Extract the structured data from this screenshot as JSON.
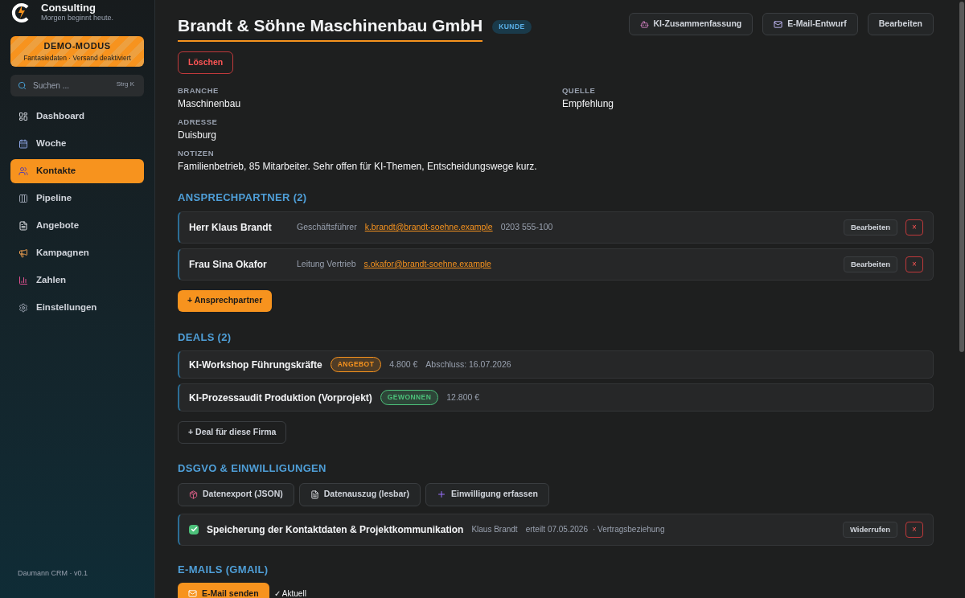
{
  "brand": {
    "name": "Consulting",
    "tagline": "Morgen beginnt heute."
  },
  "demo": {
    "title": "DEMO-MODUS",
    "subtitle": "Fantasiedaten · Versand deaktiviert"
  },
  "search": {
    "placeholder": "Suchen ...",
    "shortcut": "Strg K"
  },
  "nav": [
    {
      "label": "Dashboard",
      "selected": false
    },
    {
      "label": "Woche",
      "selected": false
    },
    {
      "label": "Kontakte",
      "selected": true
    },
    {
      "label": "Pipeline",
      "selected": false
    },
    {
      "label": "Angebote",
      "selected": false
    },
    {
      "label": "Kampagnen",
      "selected": false
    },
    {
      "label": "Zahlen",
      "selected": false
    },
    {
      "label": "Einstellungen",
      "selected": false
    }
  ],
  "version": "Daumann CRM · v0.1",
  "company": {
    "name": "Brandt & Söhne Maschinenbau GmbH",
    "badge": "KUNDE",
    "delete": "Löschen"
  },
  "actions": [
    "KI-Zusammenfassung",
    "E-Mail-Entwurf",
    "Bearbeiten"
  ],
  "fields": [
    {
      "label": "BRANCHE",
      "value": "Maschinenbau"
    },
    {
      "label": "QUELLE",
      "value": "Empfehlung"
    },
    {
      "label": "ADRESSE",
      "value": "Duisburg"
    }
  ],
  "notes": {
    "label": "NOTIZEN",
    "value": "Familienbetrieb, 85 Mitarbeiter. Sehr offen für KI-Themen, Entscheidungswege kurz."
  },
  "contacts": {
    "title": "ANSPRECHPARTNER (2)",
    "add": "+ Ansprechpartner",
    "items": [
      {
        "name": "Herr Klaus Brandt",
        "role": "Geschäftsführer",
        "email": "k.brandt@brandt-soehne.example",
        "phone": "0203 555-100",
        "edit": "Bearbeiten",
        "remove": "×"
      },
      {
        "name": "Frau Sina Okafor",
        "role": "Leitung Vertrieb",
        "email": "s.okafor@brandt-soehne.example",
        "edit": "Bearbeiten",
        "remove": "×"
      }
    ]
  },
  "deals": {
    "title": "DEALS (2)",
    "add": "+ Deal für diese Firma",
    "items": [
      {
        "name": "KI-Workshop Führungskräfte",
        "stage": "ANGEBOT",
        "color": "#f7931e",
        "amount": "4.800 €",
        "close": "Abschluss: 16.07.2026"
      },
      {
        "name": "KI-Prozessaudit Produktion (Vorprojekt)",
        "stage": "GEWONNEN",
        "color": "#4cc07a",
        "amount": "12.800 €"
      }
    ]
  },
  "gdpr": {
    "title": "DSGVO & EINWILLIGUNGEN",
    "buttons": [
      "Datenexport (JSON)",
      "Datenauszug (lesbar)",
      "Einwilligung erfassen"
    ],
    "consents": [
      {
        "checked": true,
        "title": "Speicherung der Kontaktdaten & Projektkommunikation",
        "person": "Klaus Brandt",
        "date": "erteilt 07.05.2026",
        "basis": "· Vertragsbeziehung",
        "revoke": "Widerrufen",
        "remove": "×"
      }
    ]
  },
  "emails": {
    "title": "E-MAILS (GMAIL)",
    "send": "E-Mail senden",
    "status": "✓ Aktuell"
  }
}
